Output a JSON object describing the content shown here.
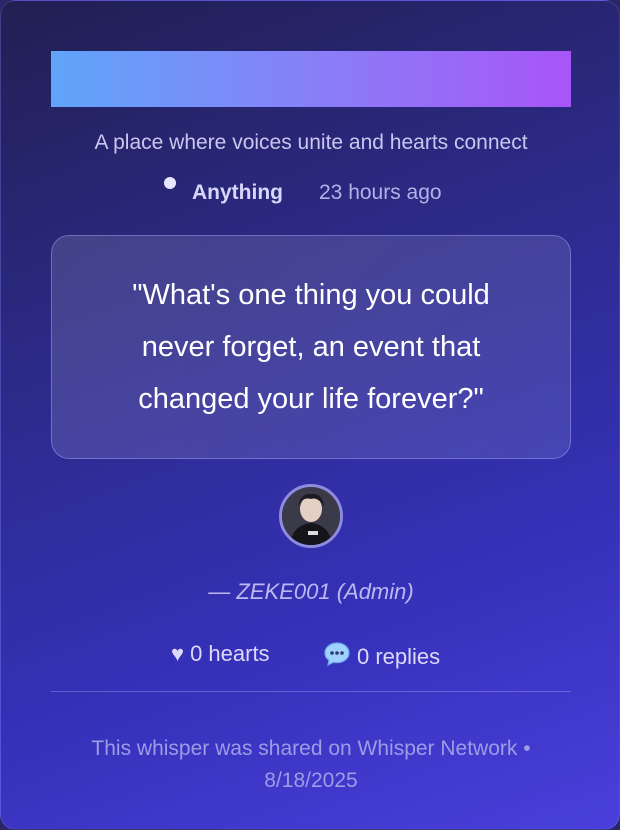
{
  "tagline": "A place where voices unite and hearts connect",
  "meta": {
    "category": "Anything",
    "time_ago": "23 hours ago"
  },
  "quote": "\"What's one thing you could never forget, an event that changed your life forever?\"",
  "author": "— ZEKE001 (Admin)",
  "stats": {
    "hearts_icon": "heart-icon",
    "hearts_label": "0 hearts",
    "replies_icon": "speech-bubble-icon",
    "replies_label": "0 replies"
  },
  "footer": "This whisper was shared on Whisper Network • 8/18/2025",
  "colors": {
    "title_bar_start": "#60a5fa",
    "title_bar_end": "#a855f7",
    "card_bg_top": "#211f52",
    "card_bg_bottom": "#4a3fdc"
  }
}
